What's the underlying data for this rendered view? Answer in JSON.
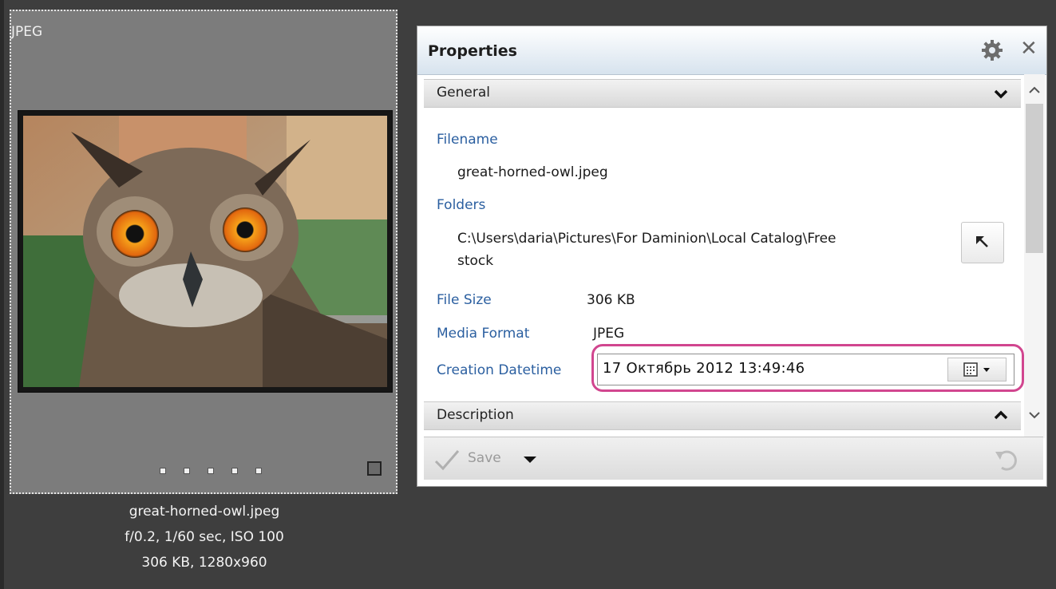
{
  "thumbnail": {
    "format": "JPEG",
    "caption": {
      "filename": "great-horned-owl.jpeg",
      "exposure": "f/0.2, 1/60 sec, ISO 100",
      "size_dims": "306 KB, 1280x960"
    }
  },
  "properties": {
    "title": "Properties",
    "icons": {
      "settings": "gear-icon",
      "close": "close-icon"
    },
    "sections": {
      "general": {
        "label": "General",
        "state": "expanded"
      },
      "description": {
        "label": "Description",
        "state": "collapsed"
      }
    },
    "fields": {
      "filename_label": "Filename",
      "filename_value": "great-horned-owl.jpeg",
      "folders_label": "Folders",
      "folders_value_line1": "C:\\Users\\daria\\Pictures\\For Daminion\\Local Catalog\\Free",
      "folders_value_line2": "stock",
      "file_size_label": "File Size",
      "file_size_value": "306 KB",
      "media_format_label": "Media Format",
      "media_format_value": "JPEG",
      "creation_datetime_label": "Creation Datetime",
      "creation_datetime_value": "17 Октябрь 2012   13:49:46"
    },
    "toolbar": {
      "save_label": "Save"
    },
    "colors": {
      "highlight": "#d1468f",
      "field_label": "#2b5fa0",
      "header_gradient_end": "#d7e3ee"
    }
  }
}
